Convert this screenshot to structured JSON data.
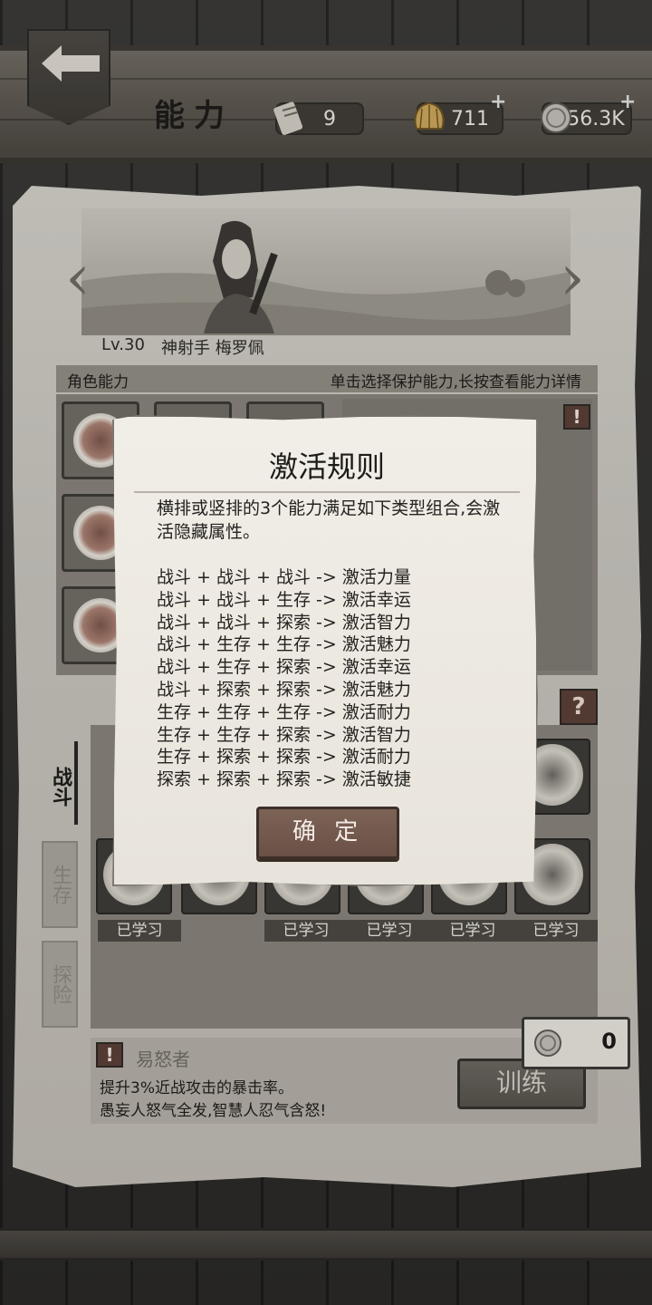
{
  "header": {
    "title": "能力",
    "scrolls": "9",
    "shells": "711",
    "coins": "56.3K"
  },
  "character": {
    "level": "Lv.30",
    "name": "神射手 梅罗佩"
  },
  "abilities": {
    "section_label": "角色能力",
    "hint": "单击选择保护能力,长按查看能力详情"
  },
  "tabs": [
    {
      "label": "战斗"
    },
    {
      "label": "生存"
    },
    {
      "label": "探险"
    }
  ],
  "skills": {
    "learned_label": "已学习"
  },
  "selected_skill": {
    "name": "易怒者",
    "desc_line1": "提升3%近战攻击的暴击率。",
    "desc_line2": "愚妄人怒气全发,智慧人忍气含怒!",
    "cost": "0",
    "train_label": "训练"
  },
  "dialog": {
    "title": "激活规则",
    "intro": "横排或竖排的3个能力满足如下类型组合,会激活隐藏属性。",
    "rules": [
      "战斗 + 战斗 + 战斗 -> 激活力量",
      "战斗 + 战斗 + 生存 -> 激活幸运",
      "战斗 + 战斗 + 探索 -> 激活智力",
      "战斗 + 生存 + 生存 -> 激活魅力",
      "战斗 + 生存 + 探索 -> 激活幸运",
      "战斗 + 探索 + 探索 -> 激活魅力",
      "生存 + 生存 + 生存 -> 激活耐力",
      "生存 + 生存 + 探索 -> 激活智力",
      "生存 + 探索 + 探索 -> 激活耐力",
      "探索 + 探索 + 探索 -> 激活敏捷"
    ],
    "confirm_label": "确 定"
  }
}
